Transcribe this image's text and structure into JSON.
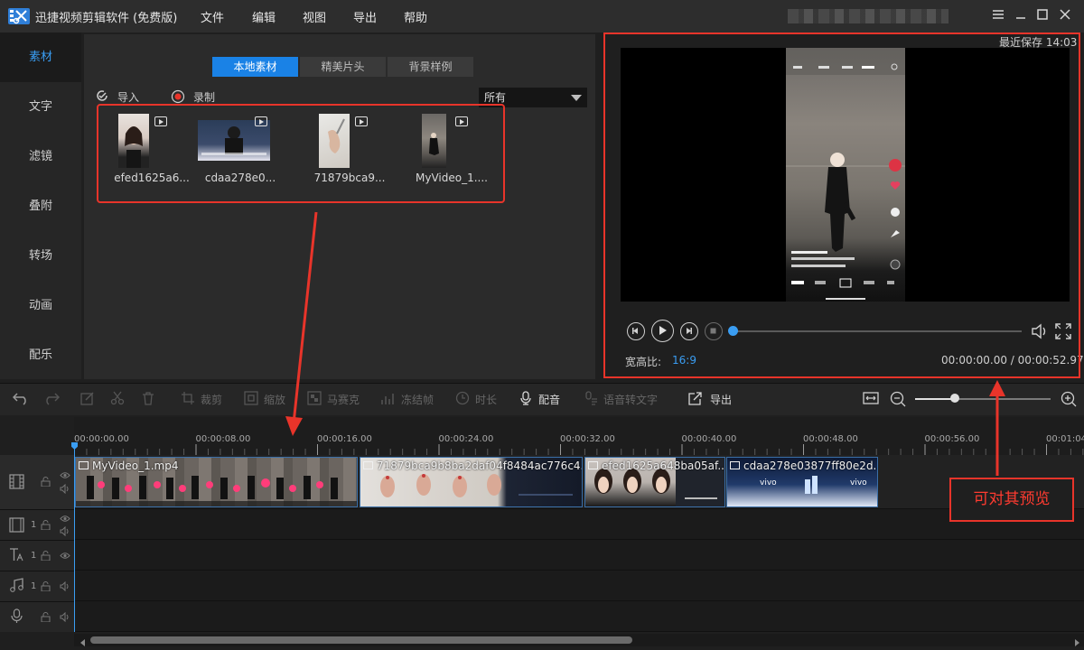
{
  "app": {
    "title": "迅捷视频剪辑软件 (免费版)"
  },
  "menu": [
    {
      "label": "文件"
    },
    {
      "label": "编辑"
    },
    {
      "label": "视图"
    },
    {
      "label": "导出"
    },
    {
      "label": "帮助"
    }
  ],
  "left_nav": [
    {
      "label": "素材",
      "active": true
    },
    {
      "label": "文字"
    },
    {
      "label": "滤镜"
    },
    {
      "label": "叠附"
    },
    {
      "label": "转场"
    },
    {
      "label": "动画"
    },
    {
      "label": "配乐"
    }
  ],
  "material": {
    "tabs": [
      {
        "label": "本地素材",
        "active": true
      },
      {
        "label": "精美片头"
      },
      {
        "label": "背景样例"
      }
    ],
    "import_label": "导入",
    "record_label": "录制",
    "filter_value": "所有",
    "items": [
      {
        "name": "efed1625a6..."
      },
      {
        "name": "cdaa278e0..."
      },
      {
        "name": "71879bca9..."
      },
      {
        "name": "MyVideo_1...."
      }
    ]
  },
  "preview": {
    "save_status": "最近保存 14:03",
    "aspect_label": "宽高比:",
    "aspect_value": "16:9",
    "time_current": "00:00:00.00",
    "time_total": "00:00:52.97",
    "progress": 0.0
  },
  "toolbar": {
    "crop": "裁剪",
    "zoom": "缩放",
    "mosaic": "马赛克",
    "freeze": "冻结帧",
    "duration": "时长",
    "voiceover": "配音",
    "speech_to_text": "语音转文字",
    "export": "导出"
  },
  "ruler": {
    "ticks": [
      "00:00:00.00",
      "00:00:08.00",
      "00:00:16.00",
      "00:00:24.00",
      "00:00:32.00",
      "00:00:40.00",
      "00:00:48.00",
      "00:00:56.00",
      "00:01:04"
    ]
  },
  "tracks": {
    "numbers": [
      "1",
      "1",
      "1",
      "1"
    ]
  },
  "clips": [
    {
      "title": "MyVideo_1.mp4"
    },
    {
      "title": "71879bca9b8ba2daf04f8484ac776c4..."
    },
    {
      "title": "efed1625a648ba05af..."
    },
    {
      "title": "cdaa278e03877ff80e2d..."
    }
  ],
  "annotation": {
    "callout": "可对其预览",
    "color": "#e8342a"
  },
  "colors": {
    "accent": "#1a82e6",
    "highlight": "#3a9df2"
  },
  "zoom_level": 0.29
}
